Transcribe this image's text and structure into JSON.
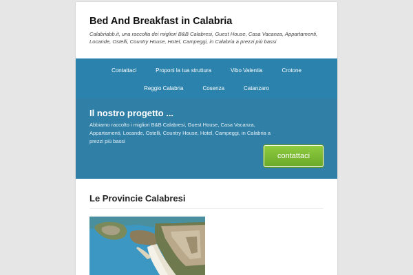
{
  "site": {
    "title": "Bed And Breakfast in Calabria",
    "description": "Calabriabb.it, una raccolta dei migliori B&B Calabresi, Guest House, Casa Vacanza, Appartamenti, Locande, Ostelli, Country House, Hotel, Campeggi, in Calabria a prezzi più bassi"
  },
  "nav": {
    "row1": [
      "Contattaci",
      "Proponi la tua struttura",
      "Vibo Valentia",
      "Crotone"
    ],
    "row2": [
      "Reggio Calabria",
      "Cosenza",
      "Catanzaro"
    ]
  },
  "hero": {
    "title": "Il nostro progetto ...",
    "text": "Abbiamo raccolto i migliori B&B Calabresi, Guest House, Casa Vacanza, Appartamenti, Locande, Ostelli, Country House, Hotel, Campeggi, in Calabria a prezzi più bassi",
    "button_label": "contattaci"
  },
  "section": {
    "title": "Le Provincie Calabresi"
  },
  "colors": {
    "nav_bg": "#2b83ad",
    "hero_bg": "#2f7fa6",
    "cta_green": "#7bbb33",
    "page_bg": "#e6e6e6"
  }
}
